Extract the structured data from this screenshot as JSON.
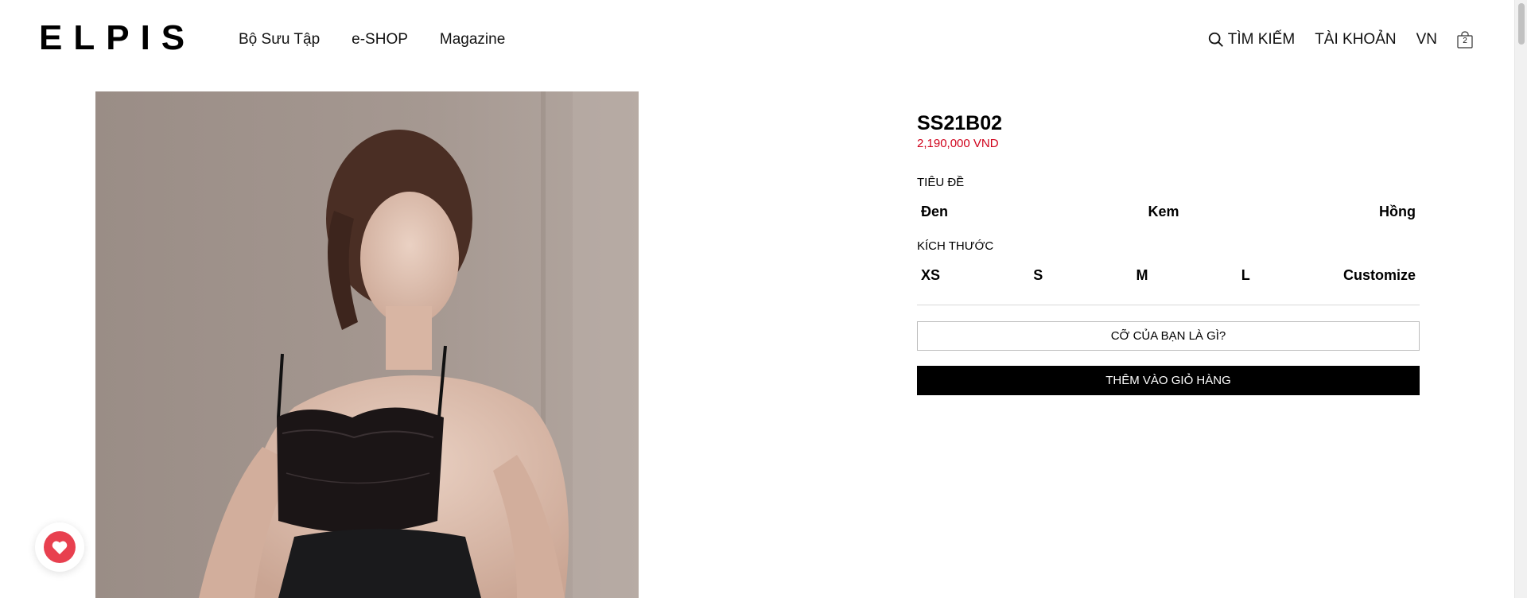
{
  "header": {
    "logo": "ELPIS",
    "nav": [
      "Bộ Sưu Tập",
      "e-SHOP",
      "Magazine"
    ],
    "search_label": "TÌM KIẾM",
    "account_label": "TÀI KHOẢN",
    "language": "VN",
    "cart_count": "2",
    "icons": {
      "search": "search-icon",
      "cart": "shopping-bag-icon"
    }
  },
  "product": {
    "sku": "SS21B02",
    "price": "2,190,000 VND",
    "color_label": "TIÊU ĐỀ",
    "colors": [
      "Đen",
      "Kem",
      "Hồng"
    ],
    "size_label": "KÍCH THƯỚC",
    "sizes": [
      "XS",
      "S",
      "M",
      "L",
      "Customize"
    ],
    "size_guide_button": "CỠ CỦA BẠN LÀ GÌ?",
    "add_to_cart_button": "THÊM VÀO GIỎ HÀNG",
    "image": "model-wearing-black-lace-bralette-photo"
  },
  "wishlist": {
    "icon": "heart-icon"
  },
  "colors": {
    "price": "#d0021b",
    "primary_button": "#000000",
    "wishlist_accent": "#e8404f"
  }
}
